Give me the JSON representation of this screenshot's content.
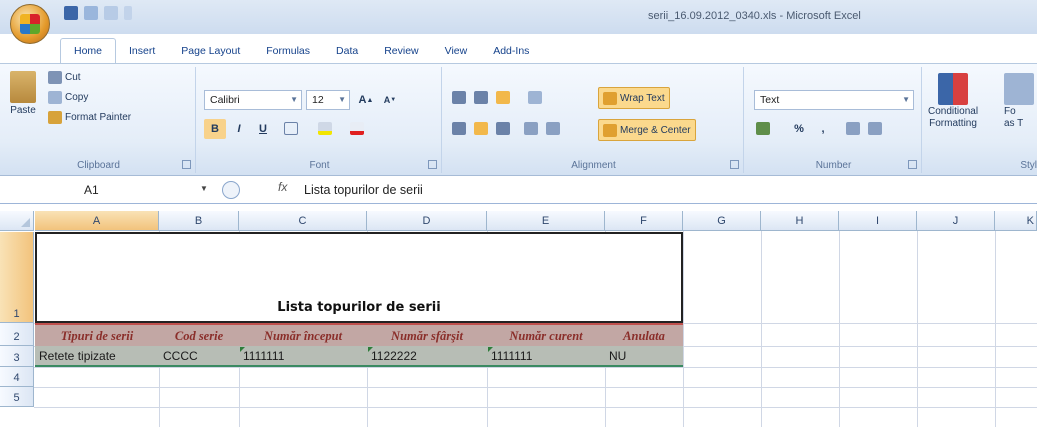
{
  "window": {
    "title": "serii_16.09.2012_0340.xls - Microsoft Excel"
  },
  "ribbon_tabs": [
    {
      "label": "Home",
      "active": true
    },
    {
      "label": "Insert"
    },
    {
      "label": "Page Layout"
    },
    {
      "label": "Formulas"
    },
    {
      "label": "Data"
    },
    {
      "label": "Review"
    },
    {
      "label": "View"
    },
    {
      "label": "Add-Ins"
    }
  ],
  "clipboard": {
    "paste": "Paste",
    "cut": "Cut",
    "copy": "Copy",
    "format_painter": "Format Painter",
    "group_label": "Clipboard"
  },
  "font": {
    "family": "Calibri",
    "size": "12",
    "group_label": "Font",
    "bold": "B",
    "italic": "I",
    "underline": "U"
  },
  "alignment": {
    "wrap_text": "Wrap Text",
    "merge_center": "Merge & Center",
    "group_label": "Alignment"
  },
  "number": {
    "format": "Text",
    "percent": "%",
    "comma": ",",
    "group_label": "Number"
  },
  "styles": {
    "conditional_formatting_line1": "Conditional",
    "conditional_formatting_line2": "Formatting",
    "format_table_line1": "Fo",
    "format_table_line2": "as T",
    "group_label": "Styl"
  },
  "formula_bar": {
    "name_box": "A1",
    "fx": "fx",
    "content": "Lista topurilor de serii"
  },
  "columns": [
    "A",
    "B",
    "C",
    "D",
    "E",
    "F",
    "G",
    "H",
    "I",
    "J",
    "K"
  ],
  "rows": [
    "1",
    "2",
    "3",
    "4",
    "5"
  ],
  "sheet": {
    "title": "Lista topurilor de serii",
    "headers": [
      "Tipuri de serii",
      "Cod serie",
      "Număr început",
      "Număr sfârşit",
      "Număr curent",
      "Anulata"
    ],
    "row3": [
      "Retete tipizate",
      "CCCC",
      "1111111",
      "1122222",
      "1111111",
      "NU"
    ]
  },
  "colors": {
    "header_row_bg": "#c2a7a4",
    "header_text": "#8a2e2a",
    "data_row_bg": "#b7bdb5",
    "data_row_border": "#3a8a62"
  }
}
